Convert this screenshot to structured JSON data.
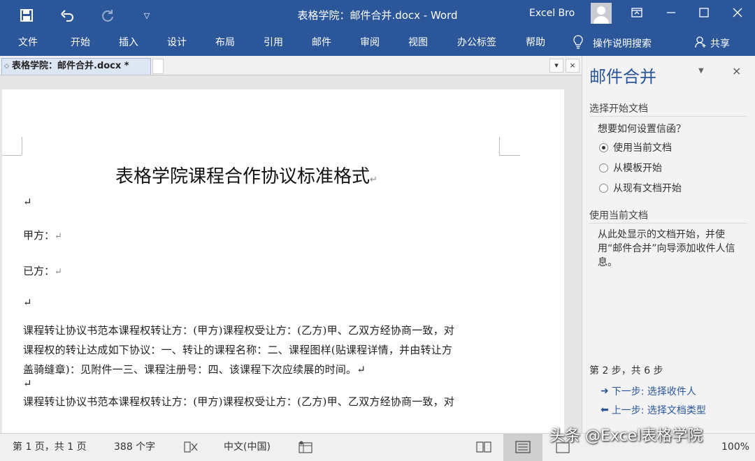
{
  "window": {
    "title": "表格学院：邮件合并.docx  -  Word",
    "user": "Excel Bro",
    "quick_access": [
      "save-icon",
      "undo-icon",
      "redo-icon",
      "customize-icon"
    ],
    "controls": [
      "ribbon-display-icon",
      "minimize-icon",
      "maximize-icon",
      "close-icon"
    ]
  },
  "ribbon": {
    "tabs": [
      "文件",
      "开始",
      "插入",
      "设计",
      "布局",
      "引用",
      "邮件",
      "审阅",
      "视图",
      "办公标签",
      "帮助"
    ],
    "tell_me": "操作说明搜索",
    "share": "共享"
  },
  "doc_tab": {
    "label": "表格学院：邮件合并.docx *",
    "dropdown": "▾",
    "close": "×"
  },
  "document": {
    "title": "表格学院课程合作协议标准格式",
    "party_a": "甲方：",
    "party_b": "已方：",
    "para_mark": "↵",
    "body_lines": [
      "课程转让协议书范本课程权转让方：(甲方)课程权受让方：(乙方)甲、乙双方经协商一致，对",
      "课程权的转让达成如下协议：一、转让的课程名称：二、课程图样(贴课程详情，并由转让方",
      "盖骑缝章)：见附件一三、课程注册号：四、该课程下次应续展的时间。↵",
      "↵",
      "课程转让协议书范本课程权转让方：(甲方)课程权受让方：(乙方)甲、乙双方经协商一致，对"
    ]
  },
  "pane": {
    "title": "邮件合并",
    "section1": "选择开始文档",
    "question": "想要如何设置信函？",
    "options": [
      {
        "label": "使用当前文档",
        "selected": true
      },
      {
        "label": "从模板开始",
        "selected": false
      },
      {
        "label": "从现有文档开始",
        "selected": false
      }
    ],
    "section2": "使用当前文档",
    "description": "从此处显示的文档开始，并使用“邮件合并”向导添加收件人信息。",
    "step": "第 2 步，共 6 步",
    "next": "下一步: 选择收件人",
    "prev": "上一步: 选择文档类型"
  },
  "status": {
    "page": "第 1 页，共 1 页",
    "words": "388 个字",
    "language": "中文(中国)",
    "zoom": "100%"
  },
  "watermark": "头条 @Excel表格学院"
}
